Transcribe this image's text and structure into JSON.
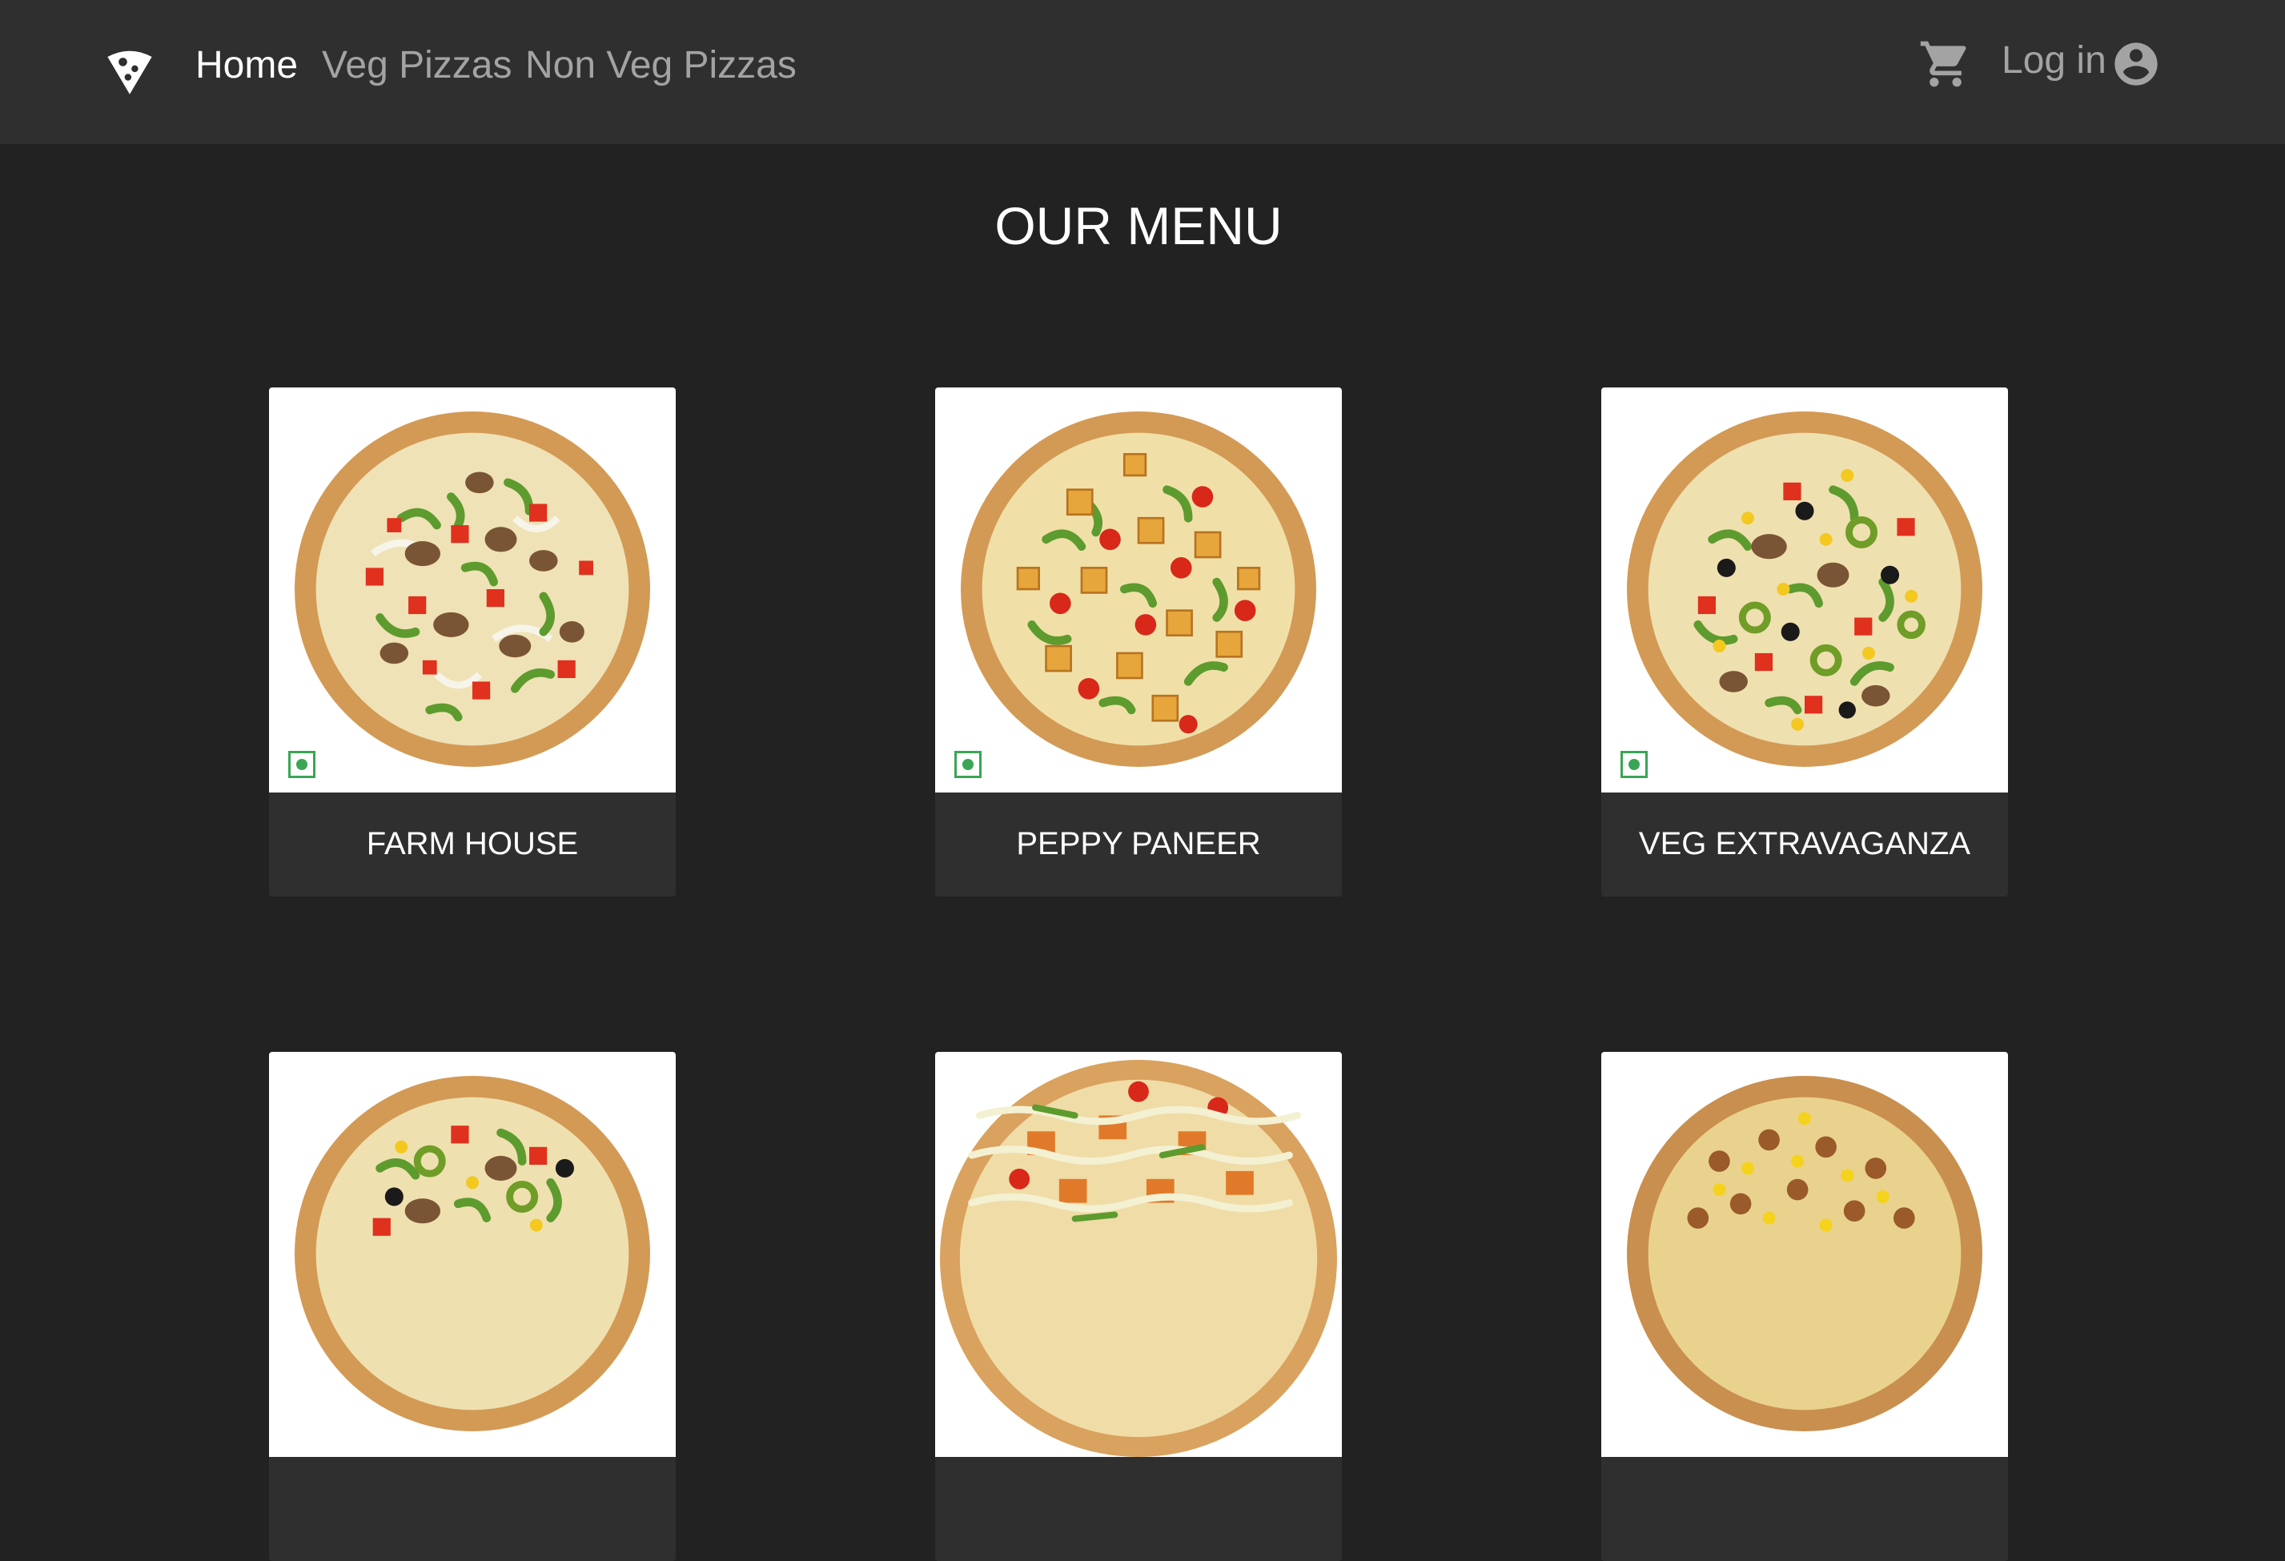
{
  "nav": {
    "logo_icon": "pizza-slice-logo-icon",
    "links": [
      {
        "label": "Home",
        "active": true
      },
      {
        "label": "Veg Pizzas",
        "active": false
      },
      {
        "label": "Non Veg Pizzas",
        "active": false
      }
    ],
    "cart_icon": "shopping-cart-icon",
    "login_label": "Log in",
    "account_icon": "account-circle-icon"
  },
  "main": {
    "title": "OUR MENU",
    "pizzas": [
      {
        "name": "FARM HOUSE",
        "veg": true
      },
      {
        "name": "PEPPY PANEER",
        "veg": true
      },
      {
        "name": "VEG EXTRAVAGANZA",
        "veg": true
      },
      {
        "name": "",
        "veg": true
      },
      {
        "name": "",
        "veg": true
      },
      {
        "name": "",
        "veg": true
      }
    ]
  },
  "colors": {
    "page_background": "#222222",
    "navbar_background": "#2f2f2f",
    "card_footer": "#2f2f2f",
    "veg_mark": "#3aa655",
    "nav_active": "#ffffff",
    "nav_inactive": "#a3a3a3"
  }
}
